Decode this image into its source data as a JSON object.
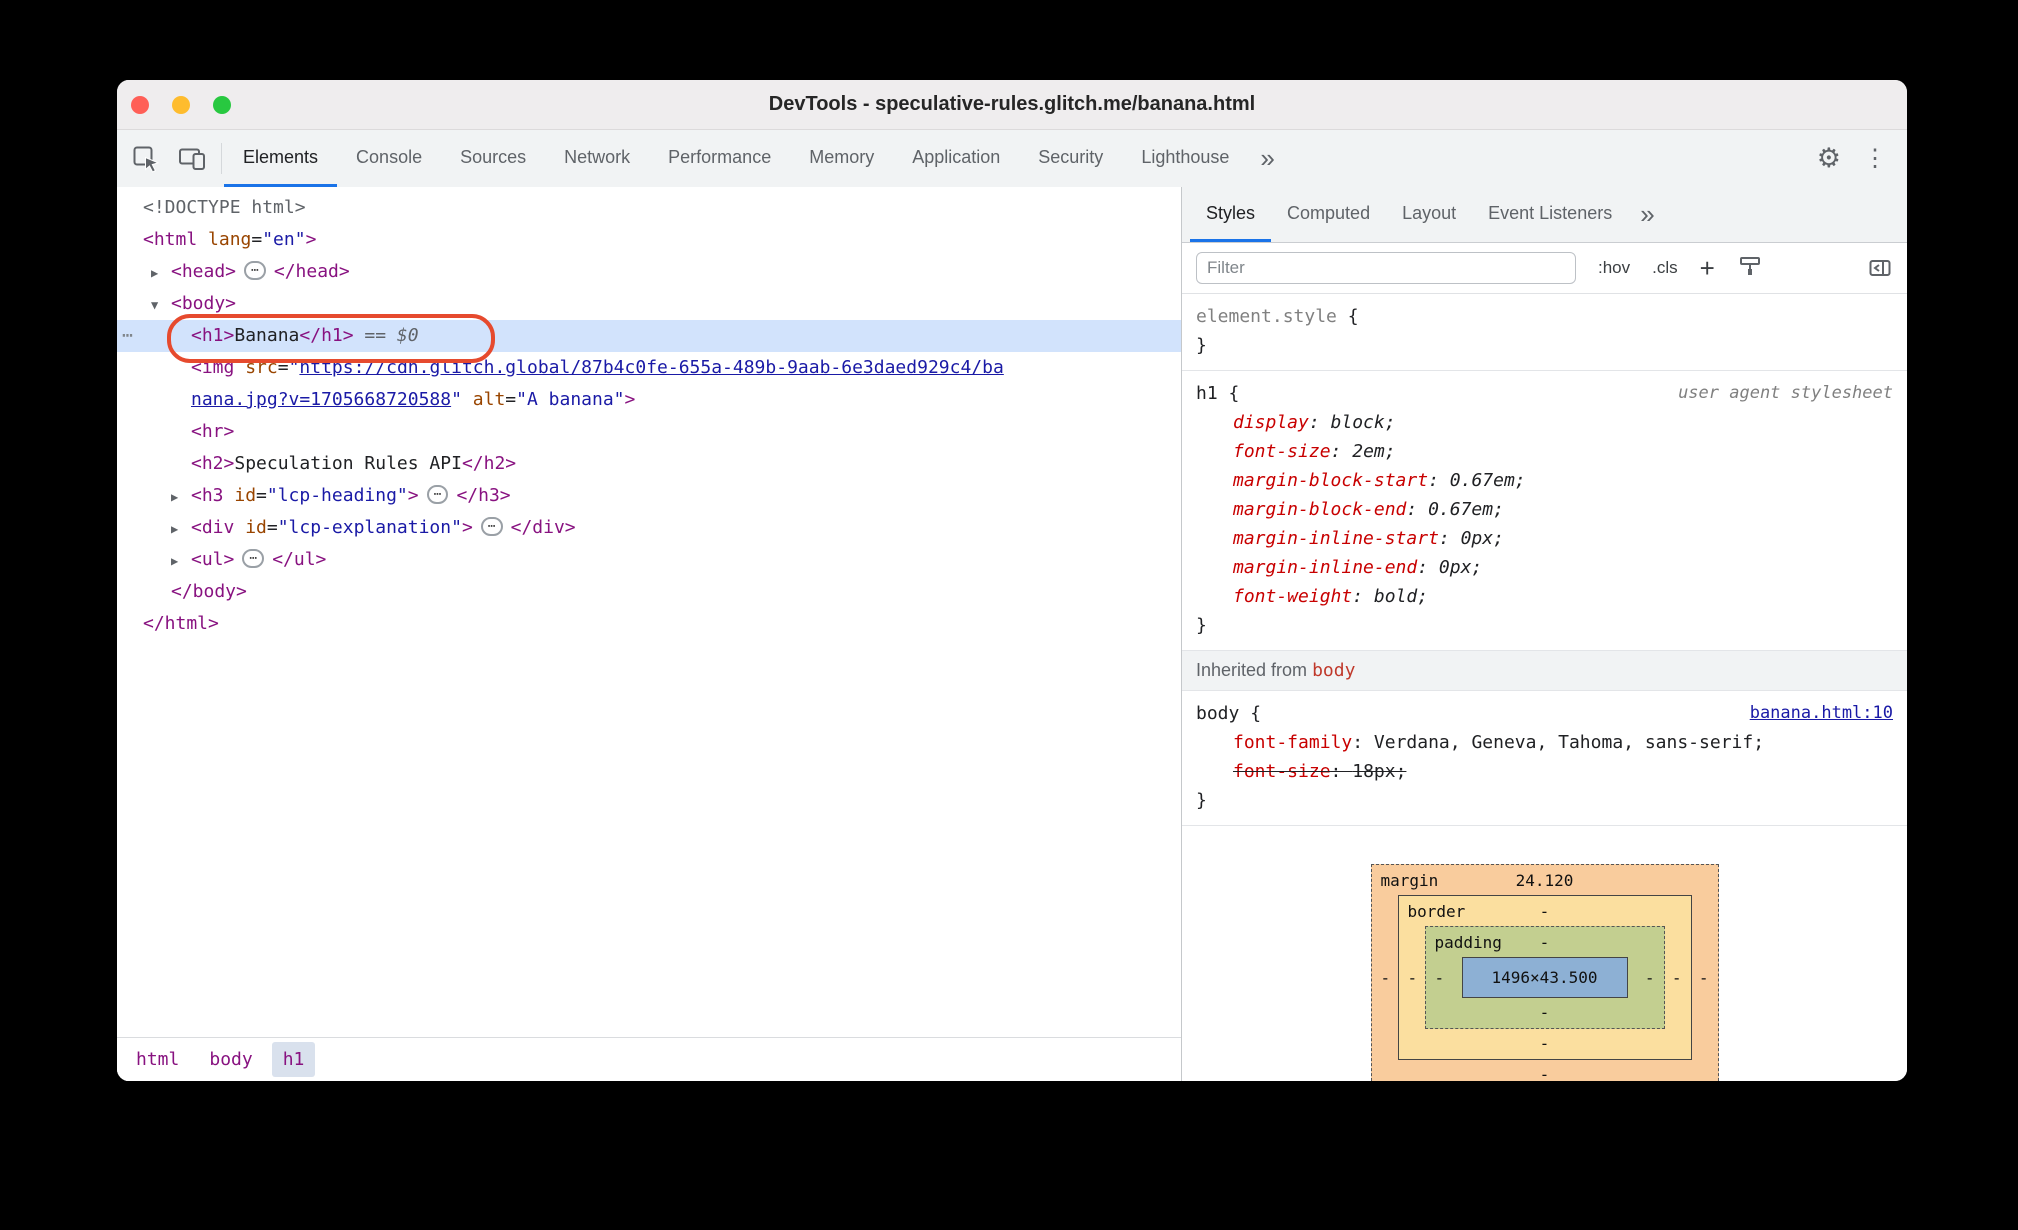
{
  "window": {
    "title": "DevTools - speculative-rules.glitch.me/banana.html"
  },
  "toolbar": {
    "tabs": [
      {
        "label": "Elements",
        "selected": true
      },
      {
        "label": "Console"
      },
      {
        "label": "Sources"
      },
      {
        "label": "Network"
      },
      {
        "label": "Performance"
      },
      {
        "label": "Memory"
      },
      {
        "label": "Application"
      },
      {
        "label": "Security"
      },
      {
        "label": "Lighthouse"
      }
    ],
    "more_tabs": "»",
    "settings_icon": "⚙",
    "menu_icon": "⋮"
  },
  "elements_tree": {
    "lines": [
      {
        "indent": 0,
        "tokens": [
          [
            "d",
            "<!DOCTYPE html>"
          ]
        ]
      },
      {
        "indent": 0,
        "tokens": [
          [
            "t",
            "<html"
          ],
          [
            "a",
            " lang"
          ],
          [
            "eq",
            "="
          ],
          [
            "v",
            "\"en\""
          ],
          [
            "t",
            ">"
          ]
        ]
      },
      {
        "indent": 1,
        "arrow": "r",
        "tokens": [
          [
            "t",
            "<head>"
          ],
          [
            "pill",
            "⋯"
          ],
          [
            "t",
            "</head>"
          ]
        ]
      },
      {
        "indent": 1,
        "arrow": "d",
        "tokens": [
          [
            "t",
            "<body>"
          ]
        ]
      },
      {
        "indent": 2,
        "selected": true,
        "gutter": "⋯",
        "annotated": true,
        "tokens": [
          [
            "t",
            "<h1>"
          ],
          [
            "x",
            "Banana"
          ],
          [
            "t",
            "</h1>"
          ],
          [
            "m",
            " == $0"
          ]
        ]
      },
      {
        "indent": 2,
        "tokens": [
          [
            "t",
            "<img"
          ],
          [
            "a",
            " src"
          ],
          [
            "eq",
            "="
          ],
          [
            "v",
            "\""
          ],
          [
            "lnk",
            "https://cdn.glitch.global/87b4c0fe-655a-489b-9aab-6e3daed929c4/ba"
          ]
        ]
      },
      {
        "indent": 2,
        "tokens": [
          [
            "lnk",
            "nana.jpg?v=1705668720588"
          ],
          [
            "v",
            "\""
          ],
          [
            "a",
            " alt"
          ],
          [
            "eq",
            "="
          ],
          [
            "v",
            "\"A banana\""
          ],
          [
            "t",
            ">"
          ]
        ]
      },
      {
        "indent": 2,
        "tokens": [
          [
            "t",
            "<hr>"
          ]
        ]
      },
      {
        "indent": 2,
        "tokens": [
          [
            "t",
            "<h2>"
          ],
          [
            "x",
            "Speculation Rules API"
          ],
          [
            "t",
            "</h2>"
          ]
        ]
      },
      {
        "indent": 2,
        "arrow": "r",
        "tokens": [
          [
            "t",
            "<h3"
          ],
          [
            "a",
            " id"
          ],
          [
            "eq",
            "="
          ],
          [
            "v",
            "\"lcp-heading\""
          ],
          [
            "t",
            ">"
          ],
          [
            "pill",
            "⋯"
          ],
          [
            "t",
            "</h3>"
          ]
        ]
      },
      {
        "indent": 2,
        "arrow": "r",
        "tokens": [
          [
            "t",
            "<div"
          ],
          [
            "a",
            " id"
          ],
          [
            "eq",
            "="
          ],
          [
            "v",
            "\"lcp-explanation\""
          ],
          [
            "t",
            ">"
          ],
          [
            "pill",
            "⋯"
          ],
          [
            "t",
            "</div>"
          ]
        ]
      },
      {
        "indent": 2,
        "arrow": "r",
        "tokens": [
          [
            "t",
            "<ul>"
          ],
          [
            "pill",
            "⋯"
          ],
          [
            "t",
            "</ul>"
          ]
        ]
      },
      {
        "indent": 1,
        "tokens": [
          [
            "t",
            "</body>"
          ]
        ]
      },
      {
        "indent": 0,
        "tokens": [
          [
            "t",
            "</html>"
          ]
        ]
      }
    ]
  },
  "breadcrumb": {
    "items": [
      {
        "label": "html"
      },
      {
        "label": "body"
      },
      {
        "label": "h1",
        "selected": true
      }
    ]
  },
  "styles_panel": {
    "tabs": [
      {
        "label": "Styles",
        "selected": true
      },
      {
        "label": "Computed"
      },
      {
        "label": "Layout"
      },
      {
        "label": "Event Listeners"
      }
    ],
    "more_tabs": "»",
    "toolbar": {
      "filter_placeholder": "Filter",
      "pseudo_toggle": ":hov",
      "class_toggle": ".cls",
      "new_rule": "+"
    },
    "sections": [
      {
        "kind": "rule",
        "selector": "element.style",
        "muted": true,
        "props": []
      },
      {
        "kind": "rule",
        "selector": "h1",
        "origin": "user agent stylesheet",
        "italic": true,
        "props": [
          {
            "name": "display",
            "value": "block"
          },
          {
            "name": "font-size",
            "value": "2em"
          },
          {
            "name": "margin-block-start",
            "value": "0.67em"
          },
          {
            "name": "margin-block-end",
            "value": "0.67em"
          },
          {
            "name": "margin-inline-start",
            "value": "0px"
          },
          {
            "name": "margin-inline-end",
            "value": "0px"
          },
          {
            "name": "font-weight",
            "value": "bold"
          }
        ]
      },
      {
        "kind": "inherited",
        "prefix": "Inherited from",
        "node": "body"
      },
      {
        "kind": "rule",
        "selector": "body",
        "link": "banana.html:10",
        "props": [
          {
            "name": "font-family",
            "value": "Verdana, Geneva, Tahoma, sans-serif"
          },
          {
            "name": "font-size",
            "value": "18px",
            "overridden": true
          }
        ]
      }
    ],
    "box_model": {
      "margin_label": "margin",
      "margin_top": "24.120",
      "border_label": "border",
      "border_top": "-",
      "padding_label": "padding",
      "padding_top": "-",
      "content": "1496×43.500",
      "side_dash": "-"
    }
  },
  "colors": {
    "tab_accent": "#1a73e8",
    "selection": "#d2e3fc",
    "annotation": "#e64a2e",
    "box_margin": "#f9cc9d",
    "box_border": "#fbdf9f",
    "box_padding": "#c3cf90",
    "box_content": "#8db0d4"
  }
}
